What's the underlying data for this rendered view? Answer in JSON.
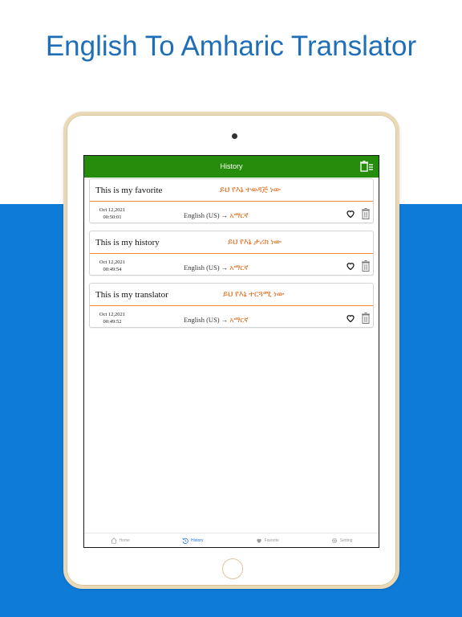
{
  "headline": "English To Amharic Translator",
  "colors": {
    "accent_green": "#268c0b",
    "brand_blue": "#0f7bd8",
    "amharic_orange": "#e26a1a",
    "headline_blue": "#1f6fb8"
  },
  "topbar": {
    "title": "History",
    "delete_icon": "delete-all-icon"
  },
  "history": [
    {
      "source": "This is my favorite",
      "target": "ይህ የእኔ ተወዳጅ ነው",
      "date": "Oct 12,2021",
      "time": "00:50:01",
      "from_lang": "English (US)",
      "arrow": "→",
      "to_lang": "አማርኛ"
    },
    {
      "source": "This is my history",
      "target": "ይህ የእኔ ታሪክ ነው",
      "date": "Oct 12,2021",
      "time": "00:49:54",
      "from_lang": "English (US)",
      "arrow": "→",
      "to_lang": "አማርኛ"
    },
    {
      "source": "This is my translator",
      "target": "ይህ የእኔ ተርጓሚ ነው",
      "date": "Oct 12,2021",
      "time": "00:49:52",
      "from_lang": "English (US)",
      "arrow": "→",
      "to_lang": "አማርኛ"
    }
  ],
  "tabs": [
    {
      "label": "Home",
      "icon": "home-icon",
      "active": false
    },
    {
      "label": "History",
      "icon": "history-icon",
      "active": true
    },
    {
      "label": "Favorite",
      "icon": "heart-icon",
      "active": false
    },
    {
      "label": "Setting",
      "icon": "gear-icon",
      "active": false
    }
  ]
}
